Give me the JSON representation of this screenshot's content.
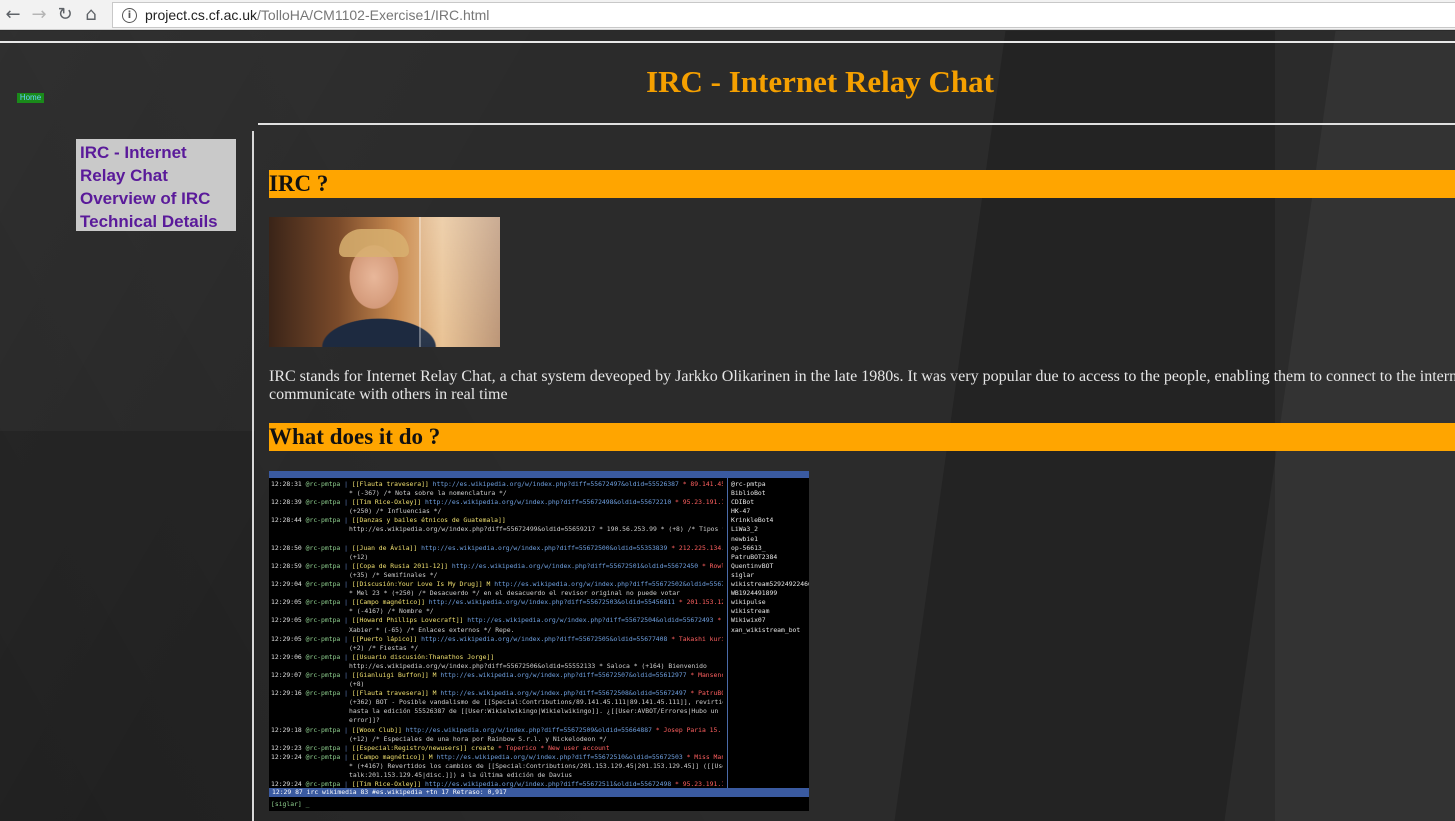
{
  "browser": {
    "back_icon": "arrow-left-icon",
    "forward_icon": "arrow-right-icon",
    "reload_icon": "reload-icon",
    "home_icon": "home-icon",
    "url_host": "project.cs.cf.ac.uk",
    "url_path": "/TolloHA/CM1102-Exercise1/IRC.html"
  },
  "page": {
    "home_link": "Home",
    "title": "IRC - Internet Relay Chat",
    "sidebar": [
      {
        "label": "IRC - Internet"
      },
      {
        "label": "Relay Chat"
      },
      {
        "label": "Overview of IRC"
      },
      {
        "label": "Technical Details"
      }
    ],
    "sections": [
      {
        "heading": "IRC ?"
      },
      {
        "heading": "What does it do ?"
      }
    ],
    "paragraph_line1": "IRC stands for Internet Relay Chat, a chat system deveoped by Jarkko Olikarinen in the late 1980s. It was very popular due to access to the people, enabling them to connect to the internet and",
    "paragraph_line2": "communicate with others in real time",
    "colors": {
      "accent": "#ffa500",
      "title": "#f5a000",
      "sidebar_link": "#5a1a9a"
    }
  },
  "irc_screenshot": {
    "lines": [
      {
        "time": "12:28:31",
        "nick": "@rc-pmtpa",
        "text": "[[Flauta travesera]]",
        "url": "http://es.wikipedia.org/w/index.php?diff=55672497&oldid=55526387",
        "extra": "* 89.141.45.111"
      },
      {
        "cont": "* (-367) /* Nota sobre la nomenclatura */"
      },
      {
        "time": "12:28:39",
        "nick": "@rc-pmtpa",
        "text": "[[Tim Rice-Oxley]]",
        "url": "http://es.wikipedia.org/w/index.php?diff=55672498&oldid=55672210",
        "extra": "* 95.23.191.159 *"
      },
      {
        "cont": "(+250) /* Influencias */"
      },
      {
        "time": "12:28:44",
        "nick": "@rc-pmtpa",
        "text": "[[Danzas y bailes étnicos de Guatemala]]",
        "url": "",
        "extra": ""
      },
      {
        "cont": "http://es.wikipedia.org/w/index.php?diff=55672499&oldid=55659217 * 190.56.253.99 * (+8) /* Tipos */"
      },
      {
        "cont": ""
      },
      {
        "time": "12:28:50",
        "nick": "@rc-pmtpa",
        "text": "[[Juan de Ávila]]",
        "url": "http://es.wikipedia.org/w/index.php?diff=55672500&oldid=55353839",
        "extra": "* 212.225.134.5 *"
      },
      {
        "cont": "(+12)"
      },
      {
        "time": "12:28:59",
        "nick": "@rc-pmtpa",
        "text": "[[Copa de Rusia 2011-12]]",
        "url": "http://es.wikipedia.org/w/index.php?diff=55672501&oldid=55672450",
        "extra": "* Rowley *"
      },
      {
        "cont": "(+35) /* Semifinales */"
      },
      {
        "time": "12:29:04",
        "nick": "@rc-pmtpa",
        "text": "[[Discusión:Your Love Is My Drug]] M",
        "url": "http://es.wikipedia.org/w/index.php?diff=55672502&oldid=55672397",
        "extra": ""
      },
      {
        "cont": "* Mel 23 * (+250) /* Desacuerdo */ en el desacuerdo el revisor original no puede votar"
      },
      {
        "time": "12:29:05",
        "nick": "@rc-pmtpa",
        "text": "[[Campo magnético]]",
        "url": "http://es.wikipedia.org/w/index.php?diff=55672503&oldid=55456811",
        "extra": "* 201.153.129.45"
      },
      {
        "cont": "* (-4167) /* Nombre */"
      },
      {
        "time": "12:29:05",
        "nick": "@rc-pmtpa",
        "text": "[[Howard Phillips Lovecraft]]",
        "url": "http://es.wikipedia.org/w/index.php?diff=55672504&oldid=55672493",
        "extra": "*"
      },
      {
        "cont": "Xabier * (-65) /* Enlaces externos */ Repe."
      },
      {
        "time": "12:29:05",
        "nick": "@rc-pmtpa",
        "text": "[[Puerto lápico]]",
        "url": "http://es.wikipedia.org/w/index.php?diff=55672505&oldid=55677408",
        "extra": "* Takashi kurita *"
      },
      {
        "cont": "(+2) /* Fiestas */"
      },
      {
        "time": "12:29:06",
        "nick": "@rc-pmtpa",
        "text": "[[Usuario discusión:Thanathos Jorge]]",
        "url": "",
        "extra": ""
      },
      {
        "cont": "http://es.wikipedia.org/w/index.php?diff=55672506&oldid=55552133 * Saloca * (+164) Bienvenido"
      },
      {
        "time": "12:29:07",
        "nick": "@rc-pmtpa",
        "text": "[[Gianluigi Buffon]] M",
        "url": "http://es.wikipedia.org/w/index.php?diff=55672507&oldid=55612977",
        "extra": "* Mansenc *"
      },
      {
        "cont": "(+8)"
      },
      {
        "time": "12:29:16",
        "nick": "@rc-pmtpa",
        "text": "[[Flauta travesera]] M",
        "url": "http://es.wikipedia.org/w/index.php?diff=55672508&oldid=55672497",
        "extra": "* PatruBOT *"
      },
      {
        "cont": "(+362) BOT - Posible vandalismo de [[Special:Contributions/89.141.45.111|89.141.45.111]], revirtiendo"
      },
      {
        "cont": "hasta la edición 55526387 de [[User:Wikielwikingo|Wikielwikingo]]. ¿[[User:AVBOT/Errores|Hubo un"
      },
      {
        "cont": "error]]?"
      },
      {
        "time": "12:29:18",
        "nick": "@rc-pmtpa",
        "text": "[[Woox Club]]",
        "url": "http://es.wikipedia.org/w/index.php?diff=55672509&oldid=55664887",
        "extra": "* Josep Paria 15. *"
      },
      {
        "cont": "(+12) /* Especiales de una hora por Rainbow S.r.l. y Nickelodeon */"
      },
      {
        "time": "12:29:23",
        "nick": "@rc-pmtpa",
        "text": "[[Especial:Registro/newusers]] create",
        "url": "",
        "extra": "* Toperico * New user account"
      },
      {
        "time": "12:29:24",
        "nick": "@rc-pmtpa",
        "text": "[[Campo magnético]] M",
        "url": "http://es.wikipedia.org/w/index.php?diff=55672510&oldid=55672503",
        "extra": "* Miss Manzana"
      },
      {
        "cont": "* (+4167) Revertidos los cambios de [[Special:Contributions/201.153.129.45|201.153.129.45]] ([[User"
      },
      {
        "cont": "talk:201.153.129.45|disc.]]) a la última edición de Davius"
      },
      {
        "time": "12:29:24",
        "nick": "@rc-pmtpa",
        "text": "[[Tim Rice-Oxley]]",
        "url": "http://es.wikipedia.org/w/index.php?diff=55672511&oldid=55672498",
        "extra": "* 95.23.191.159 *"
      },
      {
        "cont": "(+15) /* Seo Fog */"
      }
    ],
    "nicks": [
      "@rc-pmtpa",
      "BiblioBot",
      "CDIBot",
      "HK-47",
      "KrinkleBot4",
      "LiWa3_2",
      "newbie1",
      "op-56613_",
      "PatruBOT2384",
      "QuentinvBOT",
      "siglar",
      "wikistream529249224669",
      "WB1924491899",
      "wikipulse",
      "wikistream",
      "Wikiwix07",
      "xan_wikistream_bot"
    ],
    "status": "12:29    87   irc wikimedia  83 #es.wikipedia +tn   17   Retraso: 0,917",
    "input": "[siglar] _"
  }
}
